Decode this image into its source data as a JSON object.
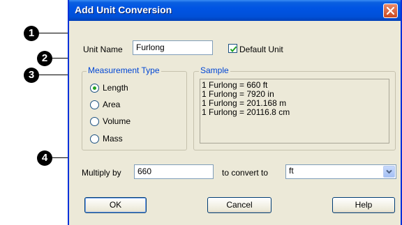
{
  "window": {
    "title": "Add Unit Conversion"
  },
  "unit_name": {
    "label": "Unit Name",
    "value": "Furlong"
  },
  "default_unit": {
    "label": "Default Unit",
    "checked": true
  },
  "measurement_type": {
    "title": "Measurement Type",
    "options": [
      "Length",
      "Area",
      "Volume",
      "Mass"
    ],
    "selected": "Length"
  },
  "sample": {
    "title": "Sample",
    "lines": [
      "1 Furlong = 660 ft",
      "1 Furlong = 7920 in",
      "1 Furlong = 201.168 m",
      "1 Furlong = 20116.8 cm"
    ]
  },
  "multiply": {
    "label": "Multiply by",
    "value": "660"
  },
  "convert_to": {
    "label": "to convert to",
    "value": "ft"
  },
  "buttons": {
    "ok": "OK",
    "cancel": "Cancel",
    "help": "Help"
  },
  "callouts": [
    "1",
    "2",
    "3",
    "4"
  ],
  "icons": {
    "close": "close-icon",
    "check": "checkmark-icon",
    "dropdown": "chevron-down-icon"
  }
}
